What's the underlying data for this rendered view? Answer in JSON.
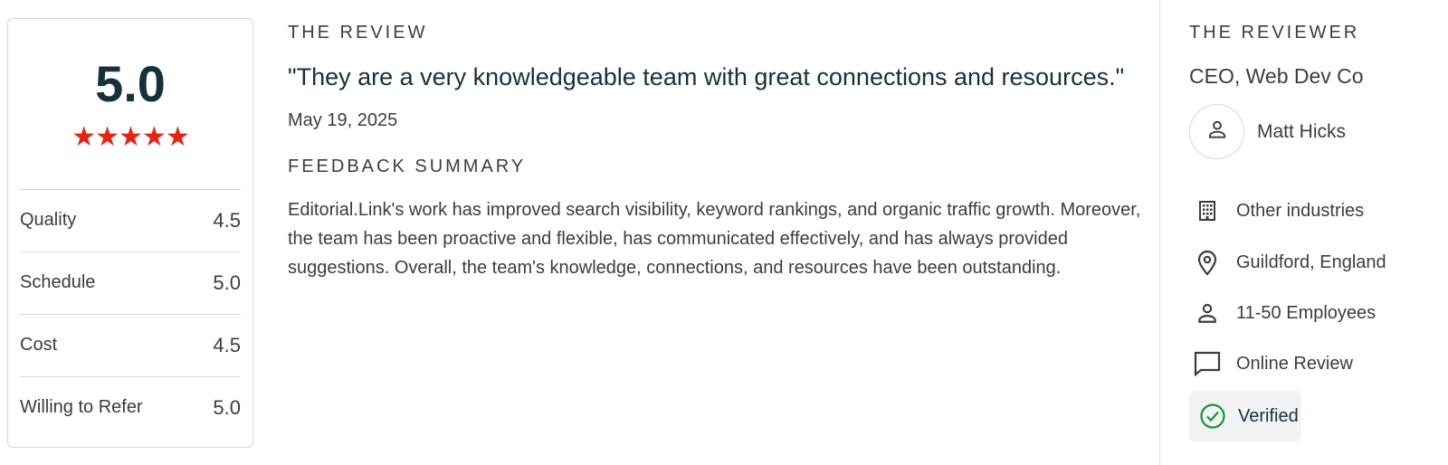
{
  "rating_card": {
    "overall_score": "5.0",
    "stars": "★★★★★",
    "stars_count": 5,
    "star_color": "#e62415",
    "scores": [
      {
        "label": "Quality",
        "value": "4.5"
      },
      {
        "label": "Schedule",
        "value": "5.0"
      },
      {
        "label": "Cost",
        "value": "4.5"
      },
      {
        "label": "Willing to Refer",
        "value": "5.0"
      }
    ]
  },
  "review": {
    "heading": "THE REVIEW",
    "quote": "\"They are a very knowledgeable team with great connections and resources.\"",
    "date": "May 19, 2025",
    "feedback_heading": "FEEDBACK SUMMARY",
    "feedback_body": "Editorial.Link's work has improved search visibility, keyword rankings, and organic traffic growth. Moreover, the team has been proactive and flexible, has communicated effectively, and has always provided suggestions. Overall, the team's knowledge, connections, and resources have been outstanding."
  },
  "reviewer": {
    "heading": "THE REVIEWER",
    "title": "CEO, Web Dev Co",
    "avatar_icon": "person-icon",
    "name": "Matt Hicks",
    "details": [
      {
        "icon": "building-icon",
        "text": "Other industries"
      },
      {
        "icon": "location-pin-icon",
        "text": "Guildford, England"
      },
      {
        "icon": "person-icon",
        "text": "11-50 Employees"
      },
      {
        "icon": "chat-bubble-icon",
        "text": "Online Review"
      }
    ],
    "verified": {
      "icon": "check-circle-icon",
      "text": "Verified",
      "color": "#1e8e3e"
    }
  }
}
